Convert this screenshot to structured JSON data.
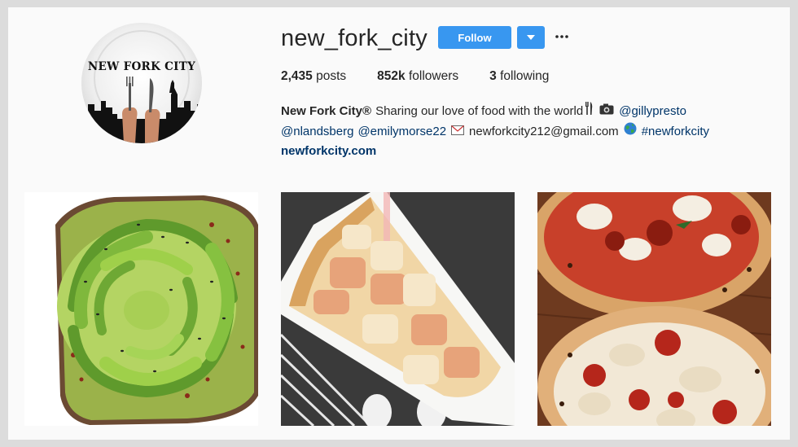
{
  "profile": {
    "username": "new_fork_city",
    "avatar_logo_text": "NEW FORK CITY",
    "follow_label": "Follow",
    "dropdown_icon": "caret-down-icon",
    "more_icon": "ellipsis-icon"
  },
  "stats": [
    {
      "count": "2,435",
      "label": "posts"
    },
    {
      "count": "852k",
      "label": "followers"
    },
    {
      "count": "3",
      "label": "following"
    }
  ],
  "bio": {
    "name": "New Fork City®",
    "line1_text": "Sharing our love of food with the world",
    "mention1": "@gillypresto",
    "mention2": "@nlandsberg",
    "mention3": "@emilymorse22",
    "email": "newforkcity212@gmail.com",
    "hashtag": "#newforkcity",
    "website": "newforkcity.com"
  },
  "posts": [
    {
      "subject": "avocado rose toast"
    },
    {
      "subject": "pizza slice on paper plate"
    },
    {
      "subject": "two margherita pizzas"
    }
  ],
  "colors": {
    "accent": "#3897f0",
    "link": "#003569"
  }
}
